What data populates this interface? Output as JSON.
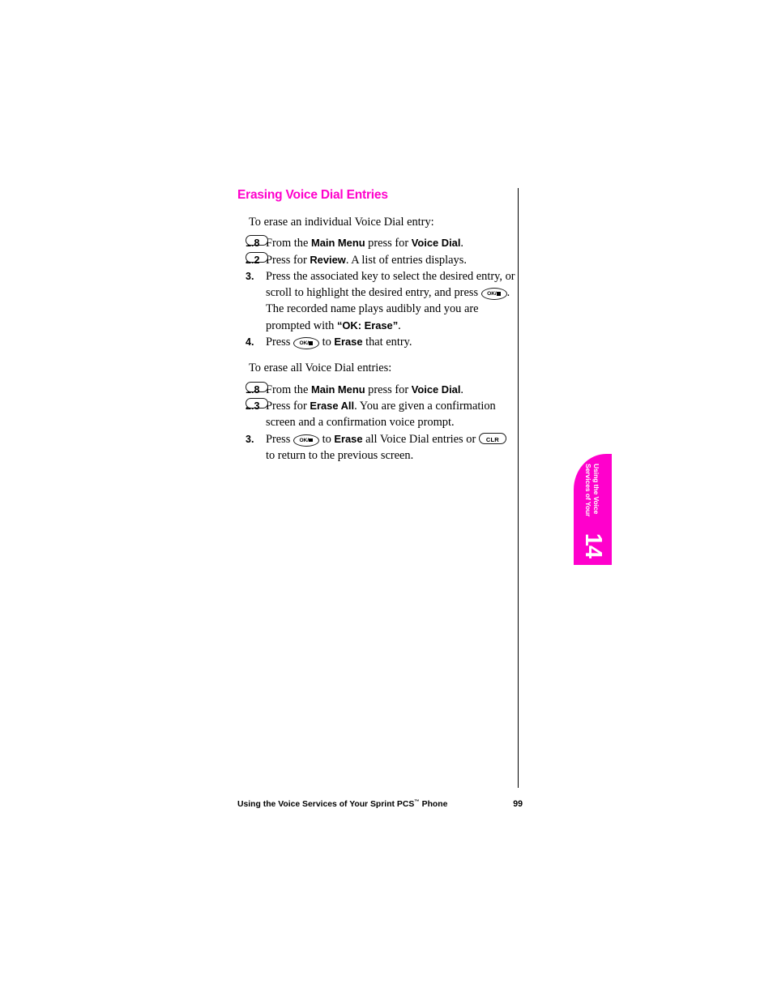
{
  "heading": "Erasing Voice Dial Entries",
  "intro_individual": "To erase an individual Voice Dial entry:",
  "intro_all": "To erase all Voice Dial entries:",
  "keys": {
    "eight": "8",
    "two": "2",
    "three": "3",
    "ok": "OK/",
    "clr": "CLR"
  },
  "steps_individual": [
    {
      "number": "1.",
      "parts": {
        "t1": "From the ",
        "b1": "Main Menu",
        "t2": " press ",
        "t3": " for ",
        "b2": "Voice Dial",
        "t4": "."
      }
    },
    {
      "number": "2.",
      "parts": {
        "t1": "Press ",
        "t2": " for ",
        "b1": "Review",
        "t3": ". A list of entries displays."
      }
    },
    {
      "number": "3.",
      "parts": {
        "t1": "Press the associated key to select the desired entry, or scroll to highlight the desired entry, and press ",
        "t2": ". The recorded name plays audibly and you are prompted with ",
        "b1": "“OK: Erase”",
        "t3": "."
      }
    },
    {
      "number": "4.",
      "parts": {
        "t1": "Press ",
        "t2": " to ",
        "b1": "Erase",
        "t3": " that entry."
      }
    }
  ],
  "steps_all": [
    {
      "number": "1.",
      "parts": {
        "t1": "From the ",
        "b1": "Main Menu",
        "t2": " press ",
        "t3": " for ",
        "b2": "Voice Dial",
        "t4": "."
      }
    },
    {
      "number": "2.",
      "parts": {
        "t1": "Press ",
        "t2": " for ",
        "b1": "Erase All",
        "t3": ". You are given a confirmation screen and a confirmation voice prompt."
      }
    },
    {
      "number": "3.",
      "parts": {
        "t1": "Press ",
        "t2": " to ",
        "b1": "Erase",
        "t3": " all Voice Dial entries or ",
        "t4": " to return to the previous screen."
      }
    }
  ],
  "chapter_tab": {
    "line1": "Using the Voice",
    "line2": "Services of Your",
    "number": "14",
    "color": "#ff00cc"
  },
  "footer": {
    "title_before_tm": "Using the Voice Services of Your Sprint PCS",
    "tm": "™",
    "title_after_tm": " Phone",
    "page_number": "99"
  }
}
